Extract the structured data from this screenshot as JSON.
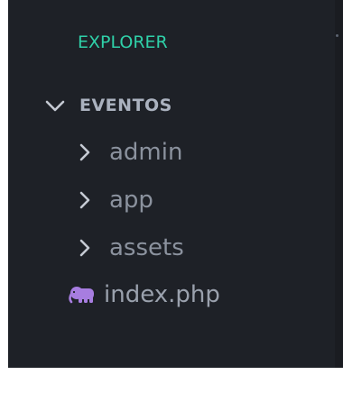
{
  "explorer": {
    "title": "EXPLORER"
  },
  "workspace": {
    "root_folder": "EVENTOS",
    "root_expanded": true,
    "items": [
      {
        "type": "folder",
        "label": "admin",
        "icon": "chevron-right-icon"
      },
      {
        "type": "folder",
        "label": "app",
        "icon": "chevron-right-icon"
      },
      {
        "type": "folder",
        "label": "assets",
        "icon": "chevron-right-icon"
      },
      {
        "type": "file",
        "label": "index.php",
        "icon": "php-elephant-icon"
      }
    ]
  },
  "colors": {
    "panel_background": "#1e2127",
    "title_accent": "#2fd0a8",
    "root_label": "#abb2bf",
    "item_label": "#8b929e",
    "php_icon": "#a77de0"
  }
}
